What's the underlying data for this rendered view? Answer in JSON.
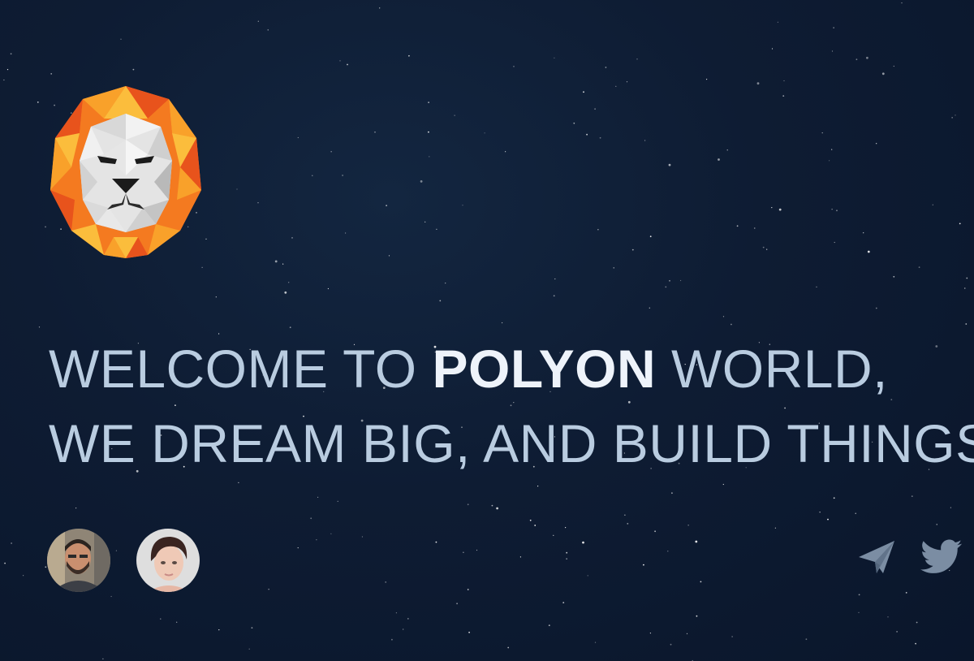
{
  "brand": {
    "logo": "lion-head-logo",
    "colors": {
      "mane_dark": "#e8531c",
      "mane_mid": "#f47a20",
      "mane_light": "#f9a12a",
      "mane_yellow": "#fbbd3c",
      "face_light": "#f2f2f2",
      "face_mid": "#d8d8d8",
      "face_dark": "#b9b9b9",
      "features": "#1b1b1b"
    }
  },
  "hero": {
    "line1_prefix": "WELCOME TO ",
    "line1_brand": "POLYON",
    "line1_suffix": " WORLD,",
    "line2": "WE DREAM BIG, AND BUILD THINGS"
  },
  "team": {
    "members": [
      {
        "avatar": "man-avatar"
      },
      {
        "avatar": "woman-avatar"
      }
    ]
  },
  "social": {
    "icons": [
      "paper-plane-icon",
      "twitter-icon"
    ],
    "color": "#7b8da3"
  },
  "theme": {
    "background": "#0e1c33",
    "headline_color": "#b9cce0",
    "headline_brand_color": "#eef3fa"
  }
}
